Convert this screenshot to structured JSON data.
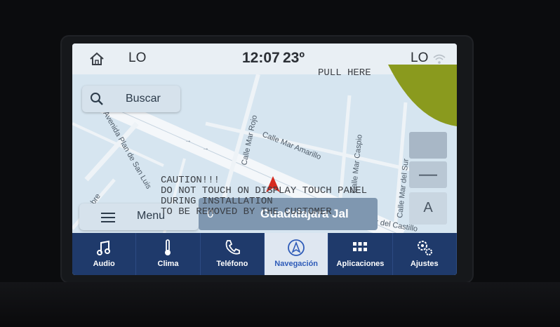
{
  "status_bar": {
    "left_label": "LO",
    "time": "12:07",
    "temperature": "23º",
    "right_label": "LO"
  },
  "map": {
    "streets": [
      {
        "name": "Calle Mar Rojo"
      },
      {
        "name": "Calle Mar Amarillo"
      },
      {
        "name": "Calle Mar Caspio"
      },
      {
        "name": "Calle Mar del Sur"
      },
      {
        "name": "Avenida Plan de San Luis"
      },
      {
        "name": "Cambre"
      },
      {
        "name": "z del Castillo"
      }
    ]
  },
  "search": {
    "label": "Buscar"
  },
  "menu": {
    "label": "Menu"
  },
  "destination": {
    "label": "Guadalajara Jal",
    "prefix": "0"
  },
  "map_controls": {
    "zoom_out_symbol": "—",
    "north_symbol": "A"
  },
  "overlay_sticker": {
    "caution_text": "CAUTION!!!\nDO NOT TOUCH ON DISPLAY TOUCH PANEL\nDURING INSTALLATION\nTO BE REMOVED BY THE CUSTOMER",
    "pull_text": "PULL HERE"
  },
  "nav_bar": {
    "items": [
      {
        "label": "Audio",
        "icon": "music-note-icon"
      },
      {
        "label": "Clima",
        "icon": "thermometer-icon"
      },
      {
        "label": "Teléfono",
        "icon": "phone-icon"
      },
      {
        "label": "Navegación",
        "icon": "navigation-icon"
      },
      {
        "label": "Aplicaciones",
        "icon": "apps-grid-icon"
      },
      {
        "label": "Ajustes",
        "icon": "gears-icon"
      }
    ],
    "active_item": "Navegación"
  },
  "colors": {
    "nav_background": "#1f3a6b",
    "nav_active": "#dfe7f1",
    "accent": "#2e5bb8",
    "map_background": "#d9e7f1",
    "peel_tab": "#8a9a1e",
    "vehicle_marker": "#d62a1e"
  }
}
